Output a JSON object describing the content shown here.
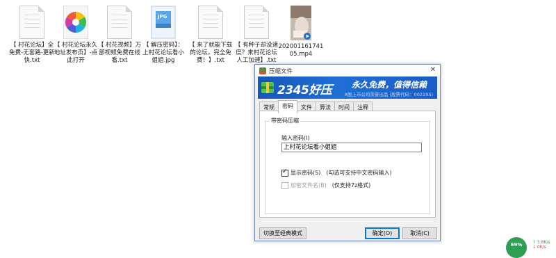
{
  "desktop": {
    "files": [
      {
        "name": "【 村花论坛】全免费-无套路-更新快.txt",
        "icon": "text-file-icon"
      },
      {
        "name": "【 村花论坛永久地址发布页】-点此打开",
        "icon": "colorful-pinwheel-icon"
      },
      {
        "name": "【 村花视频】万部视频免费在线看.txt",
        "icon": "text-file-icon"
      },
      {
        "name": "【 解压密码】：上村花论坛看小姐姐.jpg",
        "icon": "jpg-image-icon",
        "badge": "JPG"
      },
      {
        "name": "【 来了就能下载的论坛，完全免费！】.txt",
        "icon": "text-file-icon"
      },
      {
        "name": "【 有种子却没速度？来村花论坛人工加速】.txt",
        "icon": "text-file-icon"
      },
      {
        "name": "20200116174105.mp4",
        "icon": "video-thumbnail-icon"
      }
    ]
  },
  "dialog": {
    "title": "压缩文件",
    "close": "✕",
    "banner": {
      "brand": "2345好压",
      "slogan": "永久免费，值得信赖",
      "sub": "A股上市公司荣誉出品 (股票代码：002195)"
    },
    "tabs": [
      "常规",
      "密码",
      "文件",
      "算法",
      "时间",
      "注释"
    ],
    "active_tab": "密码",
    "group_title": "带密码压缩",
    "password_label": "输入密码(I)",
    "password_value": "上村花论坛看小姐姐",
    "show_password": {
      "label": "显示密码(S)",
      "hint": "(勾选可支持中文密码输入)",
      "checked": true
    },
    "encrypt_names": {
      "label": "加密文件名(B)",
      "hint": "(仅支持7z格式)",
      "checked": false,
      "disabled": true
    },
    "buttons": {
      "mode": "切换至经典模式",
      "ok": "确定(O)",
      "cancel": "取消(C)"
    }
  },
  "tray": {
    "gauge_value": "69%",
    "upload": "↑ 3.8K/s",
    "download": "↓ 0K/s"
  },
  "colors": {
    "banner": "#1e6fd6",
    "dialog_border": "#6b87b0",
    "gauge": "#2f9e55"
  }
}
